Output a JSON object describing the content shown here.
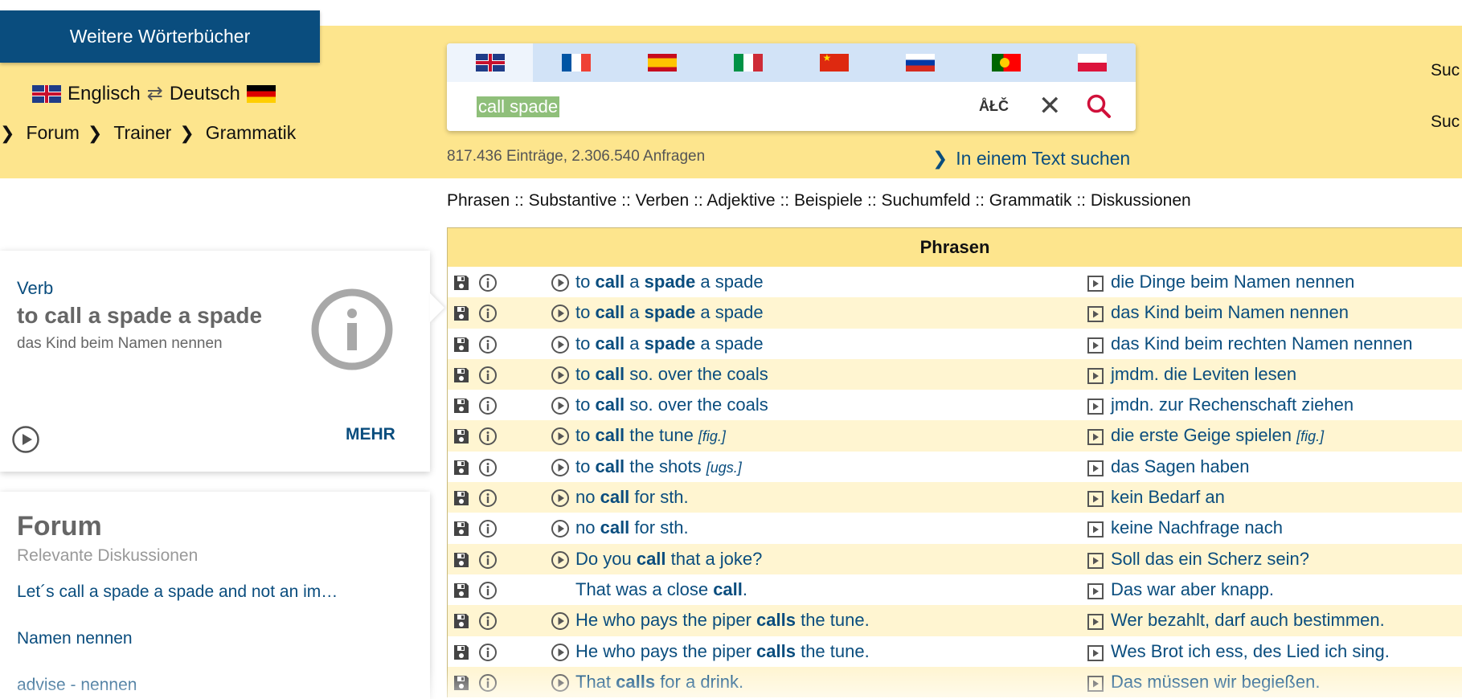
{
  "header": {
    "more_dicts": "Weitere Wörterbücher",
    "lang_from": "Englisch",
    "lang_to": "Deutsch",
    "crumbs": [
      "Forum",
      "Trainer",
      "Grammatik"
    ],
    "right1": "Suc",
    "right2": "Suc"
  },
  "search": {
    "query": "call spade",
    "special_chars": "ÅŁČ",
    "flags": [
      "gb",
      "fr",
      "es",
      "it",
      "cn",
      "ru",
      "pt",
      "pl"
    ],
    "stats": "817.436 Einträge, 2.306.540 Anfragen",
    "text_search": "In einem Text suchen"
  },
  "categories": [
    "Phrasen",
    "Substantive",
    "Verben",
    "Adjektive",
    "Beispiele",
    "Suchumfeld",
    "Grammatik",
    "Diskussionen"
  ],
  "card": {
    "type": "Verb",
    "headword": "to call a spade a spade",
    "translation": "das Kind beim Namen nennen",
    "more": "MEHR"
  },
  "forum": {
    "title": "Forum",
    "subtitle": "Relevante Diskussionen",
    "links": [
      "Let´s call a spade a spade and not an im…",
      "Namen nennen",
      "advise - nennen"
    ]
  },
  "table": {
    "header": "Phrasen",
    "rows": [
      {
        "en": [
          [
            "to ",
            0
          ],
          [
            "call",
            1
          ],
          [
            " a ",
            0
          ],
          [
            "spade",
            1
          ],
          [
            " a spade",
            0
          ]
        ],
        "en_tag": "",
        "de": "die Dinge beim Namen nennen",
        "de_tag": "",
        "play": true
      },
      {
        "en": [
          [
            "to ",
            0
          ],
          [
            "call",
            1
          ],
          [
            " a ",
            0
          ],
          [
            "spade",
            1
          ],
          [
            " a spade",
            0
          ]
        ],
        "en_tag": "",
        "de": "das Kind beim Namen nennen",
        "de_tag": "",
        "play": true
      },
      {
        "en": [
          [
            "to ",
            0
          ],
          [
            "call",
            1
          ],
          [
            " a ",
            0
          ],
          [
            "spade",
            1
          ],
          [
            " a spade",
            0
          ]
        ],
        "en_tag": "",
        "de": "das Kind beim rechten Namen nennen",
        "de_tag": "",
        "play": true
      },
      {
        "en": [
          [
            "to ",
            0
          ],
          [
            "call",
            1
          ],
          [
            " so. over the coals",
            0
          ]
        ],
        "en_tag": "",
        "de": "jmdm. die Leviten lesen",
        "de_tag": "",
        "play": true
      },
      {
        "en": [
          [
            "to ",
            0
          ],
          [
            "call",
            1
          ],
          [
            " so. over the coals",
            0
          ]
        ],
        "en_tag": "",
        "de": "jmdn. zur Rechenschaft ziehen",
        "de_tag": "",
        "play": true
      },
      {
        "en": [
          [
            "to ",
            0
          ],
          [
            "call",
            1
          ],
          [
            " the tune ",
            0
          ]
        ],
        "en_tag": "[fig.]",
        "de": "die erste Geige spielen ",
        "de_tag": "[fig.]",
        "play": true
      },
      {
        "en": [
          [
            "to ",
            0
          ],
          [
            "call",
            1
          ],
          [
            " the shots ",
            0
          ]
        ],
        "en_tag": "[ugs.]",
        "de": "das Sagen haben",
        "de_tag": "",
        "play": true
      },
      {
        "en": [
          [
            "no ",
            0
          ],
          [
            "call",
            1
          ],
          [
            " for sth.",
            0
          ]
        ],
        "en_tag": "",
        "de": "kein Bedarf an",
        "de_tag": "",
        "play": true
      },
      {
        "en": [
          [
            "no ",
            0
          ],
          [
            "call",
            1
          ],
          [
            " for sth.",
            0
          ]
        ],
        "en_tag": "",
        "de": "keine Nachfrage nach",
        "de_tag": "",
        "play": true
      },
      {
        "en": [
          [
            "Do you ",
            0
          ],
          [
            "call",
            1
          ],
          [
            " that a joke?",
            0
          ]
        ],
        "en_tag": "",
        "de": "Soll das ein Scherz sein?",
        "de_tag": "",
        "play": true
      },
      {
        "en": [
          [
            "That was a close ",
            0
          ],
          [
            "call",
            1
          ],
          [
            ".",
            0
          ]
        ],
        "en_tag": "",
        "de": "Das war aber knapp.",
        "de_tag": "",
        "play": false
      },
      {
        "en": [
          [
            "He who pays the piper ",
            0
          ],
          [
            "calls",
            1
          ],
          [
            " the tune.",
            0
          ]
        ],
        "en_tag": "",
        "de": "Wer bezahlt, darf auch bestimmen.",
        "de_tag": "",
        "play": true
      },
      {
        "en": [
          [
            "He who pays the piper ",
            0
          ],
          [
            "calls",
            1
          ],
          [
            " the tune.",
            0
          ]
        ],
        "en_tag": "",
        "de": "Wes Brot ich ess, des Lied ich sing.",
        "de_tag": "",
        "play": true
      },
      {
        "en": [
          [
            "That ",
            0
          ],
          [
            "calls",
            1
          ],
          [
            " for a drink.",
            0
          ]
        ],
        "en_tag": "",
        "de": "Das müssen wir begießen.",
        "de_tag": "",
        "play": true
      }
    ]
  },
  "colors": {
    "brand_blue": "#0a4d7e",
    "header_yellow": "#fde58d",
    "row_alt": "#fff5d1",
    "search_red": "#d0103a"
  }
}
